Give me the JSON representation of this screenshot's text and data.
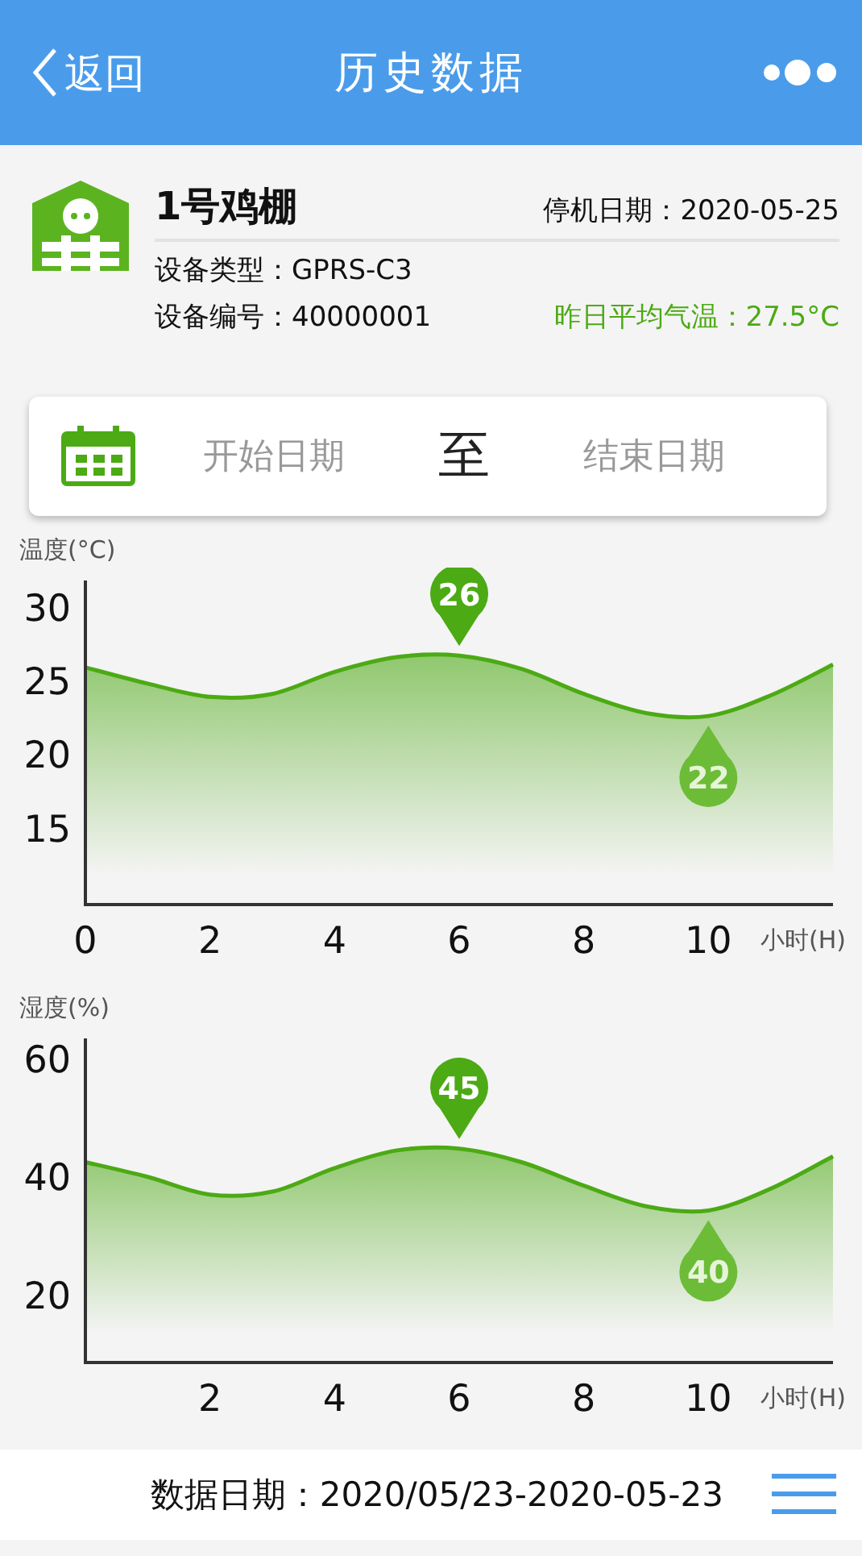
{
  "header": {
    "back": "返回",
    "title": "历史数据"
  },
  "device": {
    "name": "1号鸡棚",
    "stop_date_label": "停机日期：",
    "stop_date": "2020-05-25",
    "type_label": "设备类型：",
    "type": "GPRS-C3",
    "id_label": "设备编号：",
    "id": "40000001",
    "avg_temp_label": "昨日平均气温：",
    "avg_temp": "27.5°C"
  },
  "date_range": {
    "start_placeholder": "开始日期",
    "separator": "至",
    "end_placeholder": "结束日期"
  },
  "charts": [
    {
      "title": "温度(°C)",
      "markers": [
        {
          "kind": "max",
          "label": "26"
        },
        {
          "kind": "min",
          "label": "22"
        }
      ],
      "chart_data": {
        "type": "area",
        "xlabel": "小时(H)",
        "x": [
          0,
          1,
          2,
          3,
          4,
          5,
          6,
          7,
          8,
          9,
          10,
          11,
          12
        ],
        "series": [
          {
            "color": "#4caa14",
            "values": [
              26.1,
              25.0,
              24.1,
              24.3,
              25.8,
              26.8,
              26.9,
              26.0,
              24.3,
              23.0,
              22.8,
              24.2,
              26.3
            ]
          }
        ],
        "xlim": [
          0,
          12
        ],
        "ylim": [
          10,
          32
        ],
        "xticks": [
          0,
          2,
          4,
          6,
          8,
          10
        ],
        "yticks": [
          15,
          20,
          25,
          30
        ]
      }
    },
    {
      "title": "湿度(%)",
      "markers": [
        {
          "kind": "max",
          "label": "45"
        },
        {
          "kind": "min",
          "label": "40"
        }
      ],
      "chart_data": {
        "type": "area",
        "xlabel": "小时(H)",
        "x": [
          0,
          1,
          2,
          3,
          4,
          5,
          6,
          7,
          8,
          9,
          10,
          11,
          12
        ],
        "series": [
          {
            "color": "#4caa14",
            "values": [
              43,
              40.5,
              37.5,
              38,
              42,
              45,
              45.3,
              43,
              39,
              35.5,
              34.8,
              38.5,
              44
            ]
          }
        ],
        "xlim": [
          0,
          12
        ],
        "ylim": [
          9,
          64
        ],
        "xticks": [
          2,
          4,
          6,
          8,
          10
        ],
        "yticks": [
          20,
          40,
          60
        ]
      }
    }
  ],
  "footer": {
    "label": "数据日期：",
    "value": "2020/05/23-2020-05-23"
  }
}
